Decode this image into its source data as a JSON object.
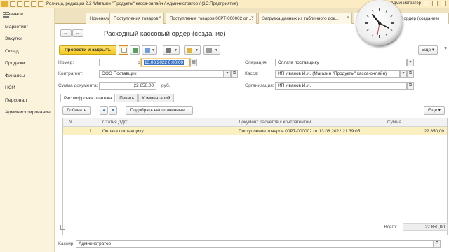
{
  "window": {
    "title": "Розница, редакция 2.2 /Магазин \"Продукты\" касса-онлайн / Администратор /  (1С:Предприятие)",
    "user": "Администратор"
  },
  "nav": {
    "items": [
      "Главное",
      "Маркетинг",
      "Закупки",
      "Склад",
      "Продажи",
      "Финансы",
      "НСИ",
      "Персонал",
      "Администрирование"
    ]
  },
  "tabs": [
    {
      "label": "Номенклатура"
    },
    {
      "label": "Поступления товаров"
    },
    {
      "label": "Поступление товаров 00РТ-000002 от ..."
    },
    {
      "label": "Загрузка данных из табличного док..."
    },
    {
      "label": "...й ордер (создание)"
    }
  ],
  "form": {
    "title": "Расходный кассовый ордер (создание)",
    "post_close": "Провести и закрыть",
    "more": "Еще",
    "help": "?",
    "labels": {
      "number": "Номер:",
      "date_from": "от",
      "counterparty": "Контрагент:",
      "amount": "Сумма документа:",
      "currency": "руб.",
      "operation": "Операция:",
      "cashbox": "Касса:",
      "organization": "Организация:"
    },
    "values": {
      "number": "",
      "date": "13.08.2022  0:00:00",
      "counterparty": "ООО Поставщик",
      "amount": "22 850,00",
      "operation": "Оплата поставщику",
      "cashbox": "ИП Иванов И.И. (Магазин \"Продукты\" касса-онлайн)",
      "organization": "ИП Иванов И.И."
    }
  },
  "subtabs": [
    "Расшифровка платежа",
    "Печать",
    "Комментарий"
  ],
  "grid_toolbar": {
    "add": "Добавить",
    "pick": "Подобрать неоплаченные...",
    "more": "Еще"
  },
  "grid": {
    "columns": [
      "N",
      "Статья ДДС",
      "Документ расчетов с контрагентом",
      "Сумма"
    ],
    "rows": [
      {
        "n": "1",
        "item": "Оплата поставщику",
        "doc": "Поступление товаров 00РТ-000002 от 13.08.2022 21:39:05",
        "sum": "22 850,00"
      }
    ]
  },
  "totals": {
    "label": "Всего:",
    "value": "22 850,00"
  },
  "footer": {
    "cashier_label": "Кассир:",
    "cashier_value": "Администратор"
  }
}
